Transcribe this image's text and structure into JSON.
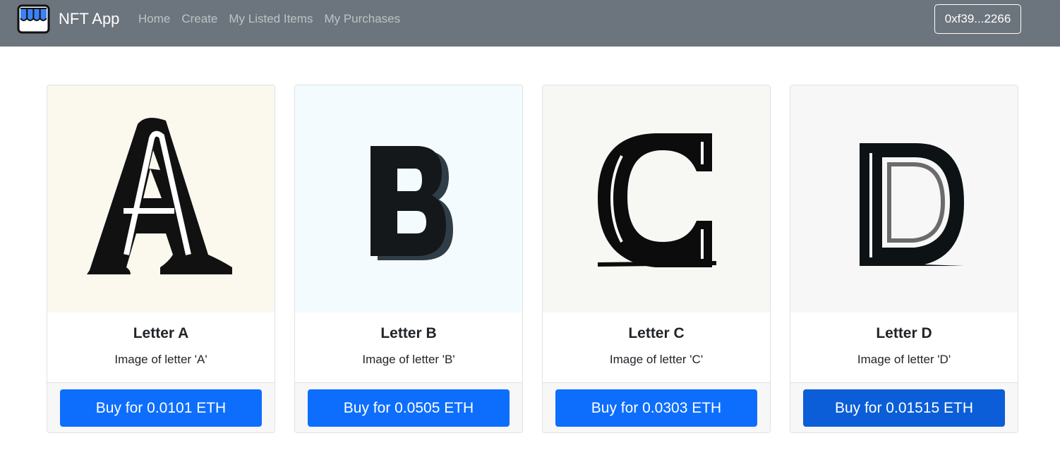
{
  "navbar": {
    "brand": "NFT App",
    "brand_icon": "storefront-icon",
    "links": [
      "Home",
      "Create",
      "My Listed Items",
      "My Purchases"
    ],
    "wallet": "0xf39...2266"
  },
  "items": [
    {
      "title": "Letter A",
      "description": "Image of letter 'A'",
      "button": "Buy for 0.0101 ETH",
      "image_bg": "#fbf8ee"
    },
    {
      "title": "Letter B",
      "description": "Image of letter 'B'",
      "button": "Buy for 0.0505 ETH",
      "image_bg": "#f3fbfe"
    },
    {
      "title": "Letter C",
      "description": "Image of letter 'C'",
      "button": "Buy for 0.0303 ETH",
      "image_bg": "#f7f7f3"
    },
    {
      "title": "Letter D",
      "description": "Image of letter 'D'",
      "button": "Buy for 0.01515 ETH",
      "image_bg": "#f7f7f7"
    }
  ],
  "colors": {
    "navbar": "#6c757d",
    "primary": "#0d6efd",
    "primary_hover": "#0b5ed7",
    "footer_bg": "#f7f7f7"
  }
}
